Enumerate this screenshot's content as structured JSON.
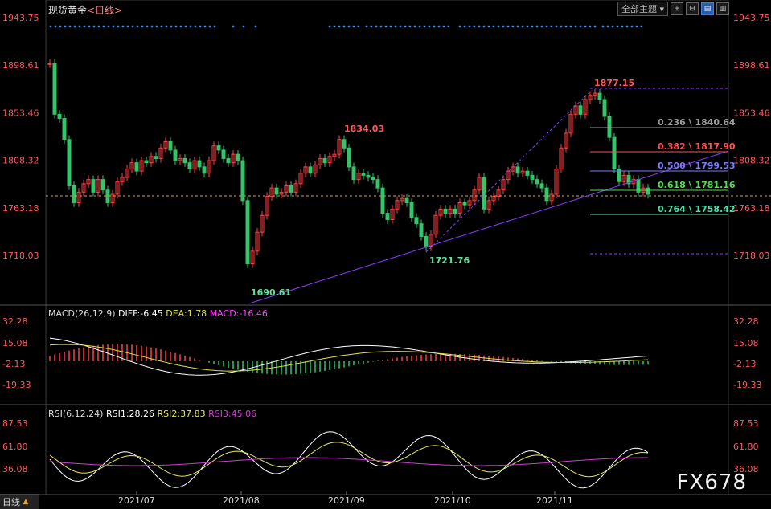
{
  "header": {
    "instrument": "现货黄金",
    "timeframe": "日线",
    "theme_select": "全部主题",
    "buttons": [
      "⊞",
      "⊟",
      "▤",
      "▥"
    ]
  },
  "bottom_tab": {
    "label": "日线",
    "arrow": "▲"
  },
  "watermark": "FX678",
  "price_axis": {
    "labels": [
      "1943.75",
      "1898.61",
      "1853.46",
      "1808.32",
      "1763.18",
      "1718.03"
    ],
    "values": [
      1943.75,
      1898.61,
      1853.46,
      1808.32,
      1763.18,
      1718.03
    ]
  },
  "date_axis": [
    "2021/07",
    "2021/08",
    "2021/09",
    "2021/10",
    "2021/11"
  ],
  "annotations": {
    "high_1": "1834.03",
    "low_1": "1690.61",
    "low_2": "1721.76",
    "high_2": "1877.15",
    "fib_levels": [
      {
        "label": "0.236 \\ 1840.64",
        "value": 1840.64,
        "color": "#9a9a9a"
      },
      {
        "label": "0.382 \\ 1817.90",
        "value": 1817.9,
        "color": "#ff5050"
      },
      {
        "label": "0.500 \\ 1799.53",
        "value": 1799.53,
        "color": "#7a7aff"
      },
      {
        "label": "0.618 \\ 1781.16",
        "value": 1781.16,
        "color": "#55dd55"
      },
      {
        "label": "0.764 \\ 1758.42",
        "value": 1758.42,
        "color": "#4fe0b0"
      }
    ]
  },
  "macd": {
    "title": "MACD(26,12,9)",
    "diff": "DIFF:-6.45",
    "dea": "DEA:1.78",
    "macd": "MACD:-16.46",
    "axis": [
      "32.28",
      "15.08",
      "-2.13",
      "-19.33"
    ],
    "axis_values": [
      32.28,
      15.08,
      -2.13,
      -19.33
    ]
  },
  "rsi": {
    "title": "RSI(6,12,24)",
    "rsi1": "RSI1:28.26",
    "rsi2": "RSI2:37.83",
    "rsi3": "RSI3:45.06",
    "axis": [
      "87.53",
      "61.80",
      "36.08"
    ],
    "axis_values": [
      87.53,
      61.8,
      36.08
    ]
  },
  "colors": {
    "up": "#ff4040",
    "down": "#35c46a",
    "macd_diff": "#ffffff",
    "macd_dea": "#e0e050",
    "rsi1": "#ffffff",
    "rsi2": "#e8e860",
    "rsi3": "#d040d0",
    "trendline": "#8a3cff",
    "dots": "#3a8ee8"
  }
}
